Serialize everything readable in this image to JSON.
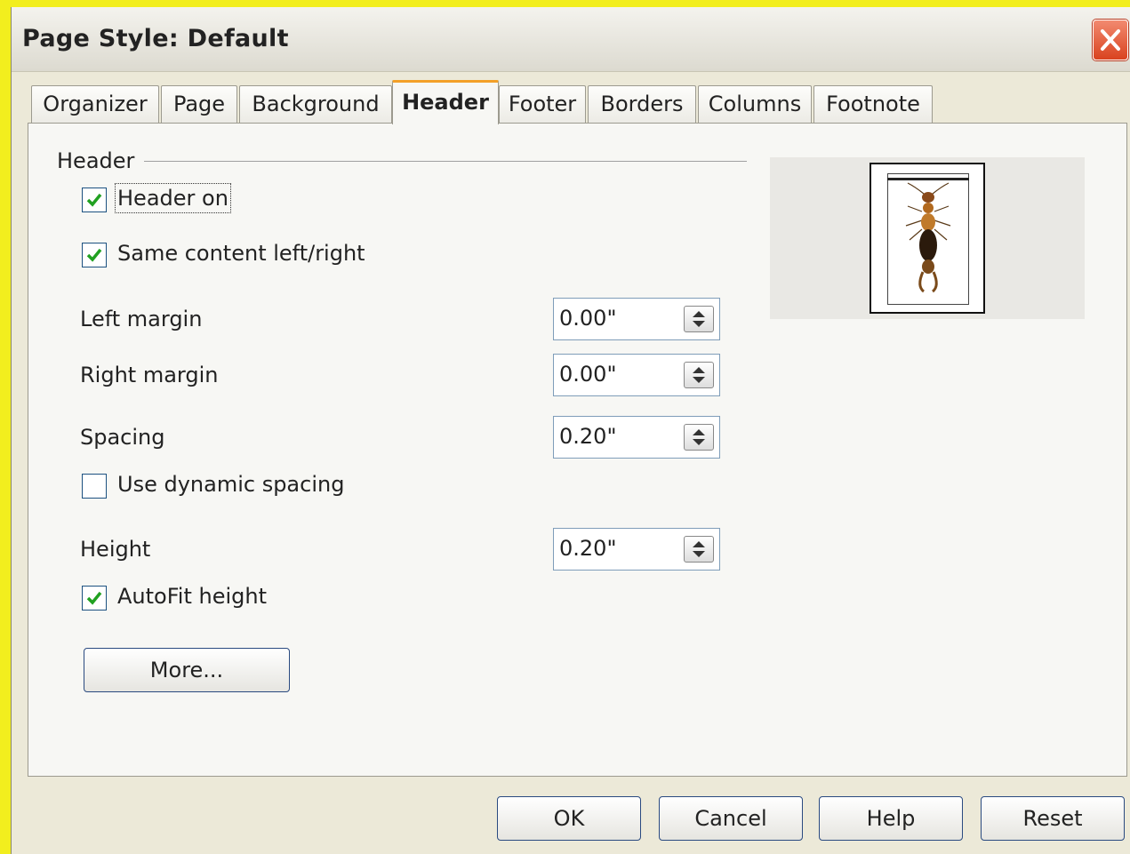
{
  "window": {
    "title": "Page Style: Default",
    "close_icon": "close-icon"
  },
  "tabs": [
    {
      "label": "Organizer",
      "active": false
    },
    {
      "label": "Page",
      "active": false
    },
    {
      "label": "Background",
      "active": false
    },
    {
      "label": "Header",
      "active": true
    },
    {
      "label": "Footer",
      "active": false
    },
    {
      "label": "Borders",
      "active": false
    },
    {
      "label": "Columns",
      "active": false
    },
    {
      "label": "Footnote",
      "active": false
    }
  ],
  "header_section": {
    "title": "Header",
    "header_on": {
      "label": "Header on",
      "checked": true
    },
    "same_content": {
      "label": "Same content left/right",
      "checked": true
    },
    "left_margin": {
      "label": "Left margin",
      "value": "0.00\""
    },
    "right_margin": {
      "label": "Right margin",
      "value": "0.00\""
    },
    "spacing": {
      "label": "Spacing",
      "value": "0.20\""
    },
    "dynamic_spacing": {
      "label": "Use dynamic spacing",
      "checked": false
    },
    "height": {
      "label": "Height",
      "value": "0.20\""
    },
    "autofit_height": {
      "label": "AutoFit height",
      "checked": true
    },
    "more_button": "More..."
  },
  "buttons": {
    "ok": "OK",
    "cancel": "Cancel",
    "help": "Help",
    "reset": "Reset"
  },
  "colors": {
    "background_yellow": "#f2ee1e",
    "active_tab_accent": "#f3a028",
    "check_green": "#21a121",
    "close_red": "#d9431f"
  }
}
